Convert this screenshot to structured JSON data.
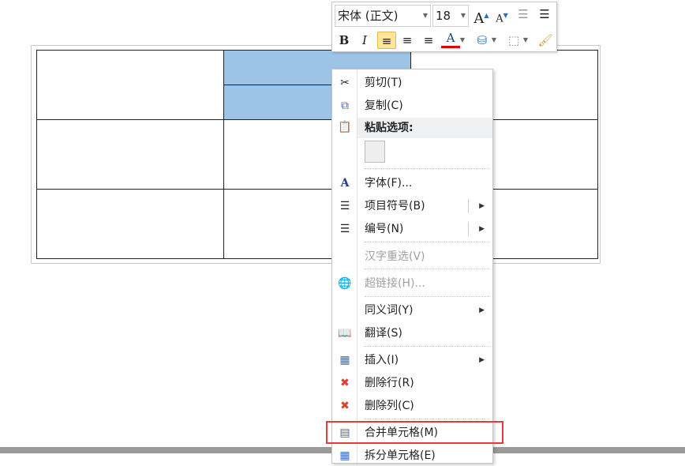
{
  "mini_toolbar": {
    "font": "宋体 (正文)",
    "size": "18",
    "bold": "B",
    "italic": "I",
    "font_color": "#e00000"
  },
  "menu": {
    "cut": "剪切(T)",
    "copy": "复制(C)",
    "paste_options": "粘贴选项:",
    "font": "字体(F)...",
    "bullets": "项目符号(B)",
    "numbering": "编号(N)",
    "reconvert": "汉字重选(V)",
    "hyperlink": "超链接(H)...",
    "synonyms": "同义词(Y)",
    "translate": "翻译(S)",
    "insert": "插入(I)",
    "delete_row": "删除行(R)",
    "delete_col": "删除列(C)",
    "merge": "合并单元格(M)",
    "split": "拆分单元格(E)"
  },
  "highlight_color": "#e83a3a"
}
